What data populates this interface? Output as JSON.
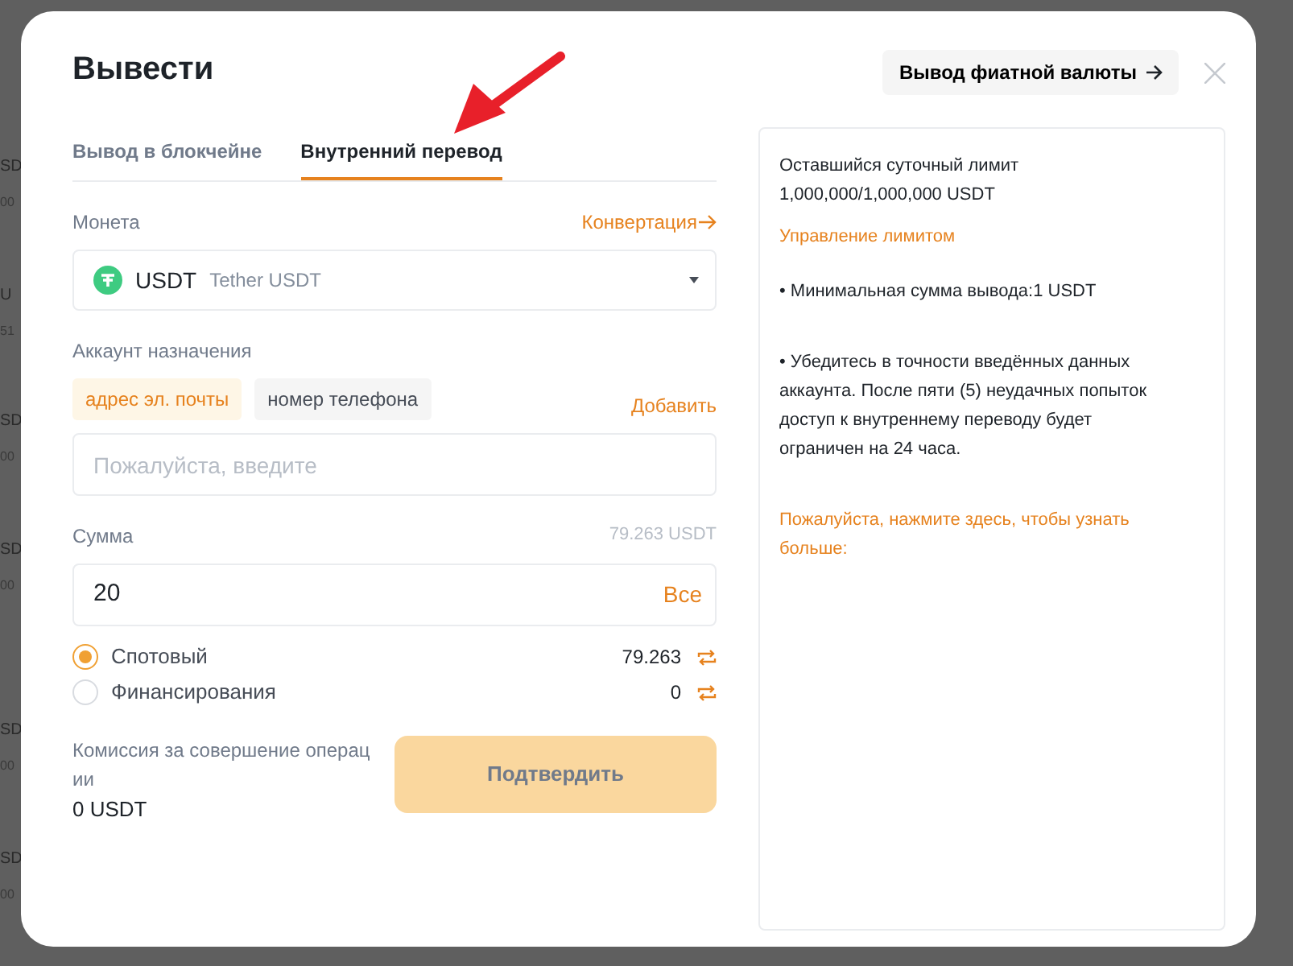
{
  "background_rows": [
    {
      "line_1": "SD",
      "line_2": "00"
    },
    {
      "line_1": "U",
      "line_2": "51"
    },
    {
      "line_1": "SD",
      "line_2": "00"
    },
    {
      "line_1": "SD",
      "line_2": "00"
    },
    {
      "line_1": "SD",
      "line_2": "00"
    },
    {
      "line_1": "SD",
      "line_2": "00"
    }
  ],
  "dialog": {
    "title": "Вывести",
    "fiat_button": "Вывод фиатной валюты"
  },
  "tabs": [
    {
      "label": "Вывод в блокчейне",
      "selected": false
    },
    {
      "label": "Внутренний перевод",
      "selected": true
    }
  ],
  "coin": {
    "label": "Монета",
    "link": "Конвертация",
    "symbol": "USDT",
    "name": "Tether USDT"
  },
  "account": {
    "label": "Аккаунт назначения",
    "types": [
      {
        "label": "адрес эл. почты",
        "selected": true
      },
      {
        "label": "номер телефона",
        "selected": false
      }
    ],
    "add_link": "Добавить",
    "placeholder": "Пожалуйста, введите"
  },
  "amount": {
    "label": "Сумма",
    "available": "79.263 USDT",
    "value": "20",
    "all_button": "Все"
  },
  "wallets": [
    {
      "label": "Спотовый",
      "balance": "79.263",
      "selected": true
    },
    {
      "label": "Финансирования",
      "balance": "0",
      "selected": false
    }
  ],
  "fee": {
    "label": "Комиссия за совершение операции",
    "value": "0 USDT"
  },
  "confirm_button": {
    "label": "Подтвердить",
    "disabled": true
  },
  "info": {
    "limit_label": "Оставшийся суточный лимит",
    "limit_value": "1,000,000/1,000,000 USDT",
    "manage_link": "Управление лимитом",
    "notes": [
      "• Минимальная сумма вывода:1 USDT",
      "• Убедитесь в точности введённых данных аккаунта. После пяти (5) неудачных попыток доступ к внутреннему переводу будет ограничен на 24 часа."
    ],
    "more_link": "Пожалуйста, нажмите здесь, чтобы узнать больше:"
  }
}
